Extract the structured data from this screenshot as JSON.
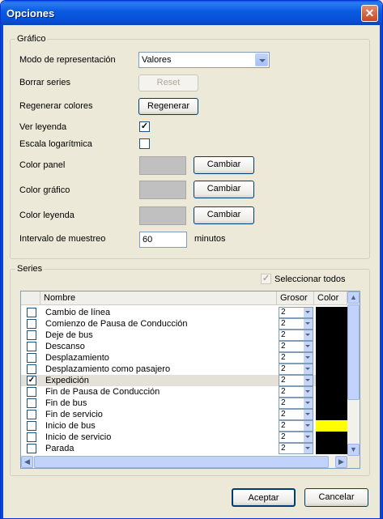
{
  "window": {
    "title": "Opciones",
    "close_glyph": "✕"
  },
  "grafico": {
    "group_title": "Gráfico",
    "modo_label": "Modo de representación",
    "modo_value": "Valores",
    "borrar_label": "Borrar series",
    "reset_button": "Reset",
    "regenerar_label": "Regenerar colores",
    "regenerar_button": "Regenerar",
    "ver_leyenda_label": "Ver leyenda",
    "ver_leyenda_checked": true,
    "escala_label": "Escala logarítmica",
    "escala_checked": false,
    "color_panel_label": "Color panel",
    "color_grafico_label": "Color gráfico",
    "color_leyenda_label": "Color leyenda",
    "cambiar_label": "Cambiar",
    "intervalo_label": "Intervalo de muestreo",
    "intervalo_value": "60",
    "intervalo_unit": "minutos"
  },
  "series": {
    "group_title": "Series",
    "select_all_label": "Seleccionar todos",
    "columns": {
      "nombre": "Nombre",
      "grosor": "Grosor",
      "color": "Color"
    },
    "rows": [
      {
        "name": "Cambio de línea",
        "checked": false,
        "grosor": "2",
        "color": "#000000"
      },
      {
        "name": "Comienzo de Pausa de Conducción",
        "checked": false,
        "grosor": "2",
        "color": "#000000"
      },
      {
        "name": "Deje de bus",
        "checked": false,
        "grosor": "2",
        "color": "#000000"
      },
      {
        "name": "Descanso",
        "checked": false,
        "grosor": "2",
        "color": "#000000"
      },
      {
        "name": "Desplazamiento",
        "checked": false,
        "grosor": "2",
        "color": "#000000"
      },
      {
        "name": "Desplazamiento como pasajero",
        "checked": false,
        "grosor": "2",
        "color": "#000000"
      },
      {
        "name": "Expedición",
        "checked": true,
        "grosor": "2",
        "color": "#000000"
      },
      {
        "name": "Fin de Pausa de Conducción",
        "checked": false,
        "grosor": "2",
        "color": "#000000"
      },
      {
        "name": "Fin de bus",
        "checked": false,
        "grosor": "2",
        "color": "#000000"
      },
      {
        "name": "Fin de servicio",
        "checked": false,
        "grosor": "2",
        "color": "#000000"
      },
      {
        "name": "Inicio de bus",
        "checked": false,
        "grosor": "2",
        "color": "#ffff00"
      },
      {
        "name": "Inicio de servicio",
        "checked": false,
        "grosor": "2",
        "color": "#000000"
      },
      {
        "name": "Parada",
        "checked": false,
        "grosor": "2",
        "color": "#000000"
      }
    ]
  },
  "footer": {
    "accept_button": "Aceptar",
    "cancel_button": "Cancelar"
  }
}
